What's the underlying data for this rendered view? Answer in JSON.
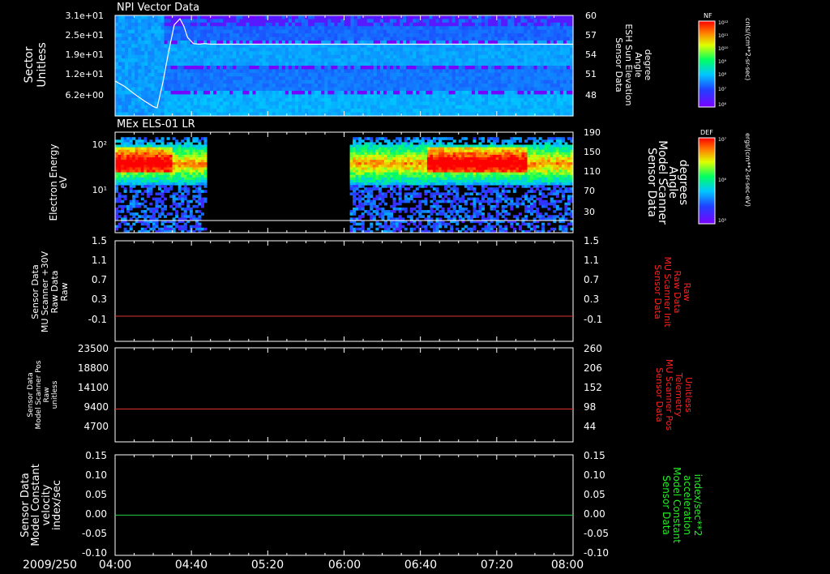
{
  "time_axis": {
    "date_label": "2009/250",
    "ticks": [
      "04:00",
      "04:40",
      "05:20",
      "06:00",
      "06:40",
      "07:20",
      "08:00"
    ],
    "range": [
      "04:00",
      "08:00"
    ]
  },
  "chart_data": [
    {
      "type": "heatmap",
      "panel_id": "npi",
      "title": "NPI Vector Data",
      "ylabel_left": [
        "Sector",
        "Unitless"
      ],
      "yticks_left": [
        "3.1e+01",
        "2.5e+01",
        "1.9e+01",
        "1.2e+01",
        "6.2e+00"
      ],
      "ylabel_right": [
        "Sensor Data",
        "ESH Sun Elevation",
        "Angle",
        "degree"
      ],
      "yticks_right": [
        "60",
        "57",
        "54",
        "51",
        "48"
      ],
      "ylim_right": [
        45,
        60
      ],
      "colorbar": {
        "label": "NF",
        "unit": "cnts/(cm**2-sr-sec)",
        "ticks": [
          "10¹²",
          "10¹¹",
          "10¹⁰",
          "10⁹",
          "10⁸",
          "10⁷",
          "10⁶"
        ]
      },
      "overlay_line": {
        "color": "#ffffff",
        "x": [
          "04:00",
          "04:05",
          "04:10",
          "04:15",
          "04:20",
          "04:22",
          "04:25",
          "04:28",
          "04:31",
          "04:34",
          "04:36",
          "04:38",
          "04:41",
          "04:44",
          "04:47",
          "04:50",
          "05:00",
          "05:30",
          "06:00",
          "07:00",
          "08:00"
        ],
        "y": [
          50.2,
          49.4,
          48.3,
          47.3,
          46.4,
          46.2,
          50.0,
          54.5,
          58.6,
          59.5,
          58.4,
          56.7,
          55.8,
          55.7,
          55.8,
          55.7,
          55.7,
          55.7,
          55.7,
          55.7,
          55.7
        ]
      }
    },
    {
      "type": "heatmap",
      "panel_id": "els",
      "title": "MEx ELS-01 LR",
      "ylabel_left": [
        "Electron Energy",
        "eV"
      ],
      "yticks_left": [
        "10²",
        "10¹"
      ],
      "ylabel_right": [
        "Sensor Data",
        "Model Scanner",
        "Angle",
        "degrees"
      ],
      "yticks_right": [
        "190",
        "150",
        "110",
        "70",
        "30"
      ],
      "ylim_right": [
        0,
        190
      ],
      "colorbar": {
        "label": "DEF",
        "unit": "ergs/(cm**2-sr-sec-eV)",
        "ticks": [
          "10⁷",
          "10⁶",
          "10⁵"
        ]
      },
      "data_gaps": [
        [
          "04:49",
          "06:03"
        ]
      ]
    },
    {
      "type": "line",
      "panel_id": "p3",
      "ylabel_left": [
        "Sensor Data",
        "MU Scanner +30V",
        "Raw Data",
        "Raw"
      ],
      "yticks_left": [
        "1.5",
        "1.1",
        "0.7",
        "0.3",
        "-0.1"
      ],
      "ylim_left": [
        -0.5,
        1.5
      ],
      "ylabel_right": [
        "Sensor Data",
        "MU Scanner Init",
        "Raw Data",
        "Raw"
      ],
      "yticks_right": [
        "1.5",
        "1.1",
        "0.7",
        "0.3",
        "-0.1"
      ],
      "ylim_right": [
        -0.5,
        1.5
      ],
      "series": [
        {
          "color": "#e03030",
          "x": [
            "04:00",
            "08:00"
          ],
          "y": [
            0.0,
            0.0
          ]
        }
      ]
    },
    {
      "type": "line",
      "panel_id": "p4",
      "ylabel_left": [
        "Sensor Data",
        "Model Scanner Pos",
        "Raw",
        "unitless"
      ],
      "yticks_left": [
        "23500",
        "18800",
        "14100",
        "9400",
        "4700"
      ],
      "ylim_left": [
        0,
        23500
      ],
      "ylabel_right": [
        "Sensor Data",
        "MU Scanner Pos",
        "Telemetry",
        "Unitless"
      ],
      "yticks_right": [
        "260",
        "206",
        "152",
        "98",
        "44"
      ],
      "ylim_right": [
        -10,
        260
      ],
      "series": [
        {
          "color": "#e03030",
          "x": [
            "04:00",
            "08:00"
          ],
          "y": [
            8200,
            8200
          ]
        }
      ]
    },
    {
      "type": "line",
      "panel_id": "p5",
      "ylabel_left": [
        "Sensor Data",
        "Model Constant",
        "velocity",
        "index/sec"
      ],
      "yticks_left": [
        "0.15",
        "0.10",
        "0.05",
        "0.00",
        "-0.05",
        "-0.10"
      ],
      "ylim_left": [
        -0.1,
        0.15
      ],
      "ylabel_right": [
        "Sensor Data",
        "Model Constant",
        "acceleration",
        "index/sec**2"
      ],
      "yticks_right": [
        "0.15",
        "0.10",
        "0.05",
        "0.00",
        "-0.05",
        "-0.10"
      ],
      "ylim_right": [
        -0.1,
        0.15
      ],
      "series": [
        {
          "color": "#20d040",
          "x": [
            "04:00",
            "08:00"
          ],
          "y": [
            0.0,
            0.0
          ]
        }
      ]
    }
  ],
  "colors": {
    "red_label": "#ff2020",
    "green_label": "#22ee22",
    "axis": "#ffffff"
  }
}
